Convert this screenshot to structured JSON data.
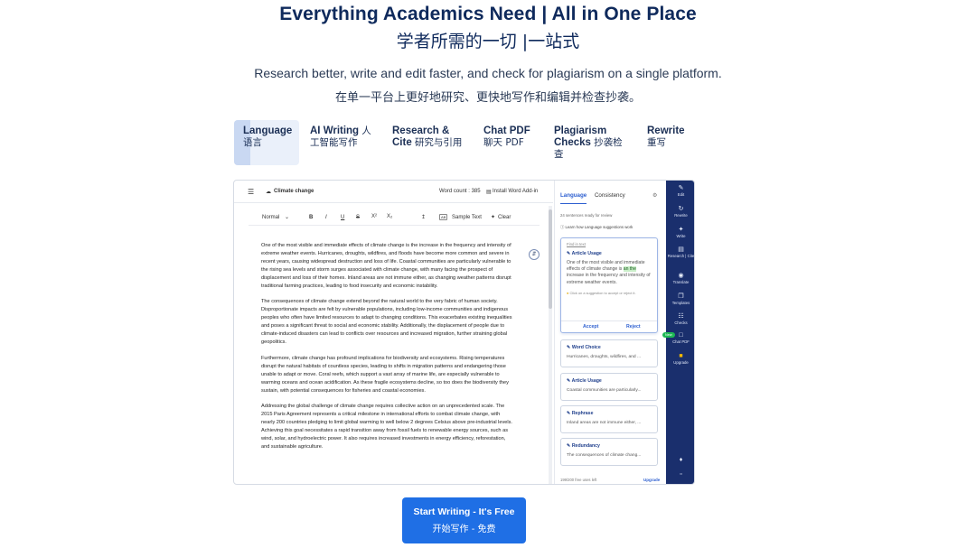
{
  "hero": {
    "title": "Everything Academics Need | All in One Place",
    "title_zh": "学者所需的一切 |一站式",
    "subtitle": "Research better, write and edit faster, and check for plagiarism on a single platform.",
    "subtitle_zh": "在单一平台上更好地研究、更快地写作和编辑并检查抄袭。"
  },
  "tabs": [
    {
      "label": "Language",
      "label_zh": "语言",
      "active": true
    },
    {
      "label": "AI Writing",
      "label_zh": "人工智能写作"
    },
    {
      "label": "Research & Cite",
      "label_zh": "研究与引用"
    },
    {
      "label": "Chat PDF",
      "label_zh": "聊天 PDF"
    },
    {
      "label": "Plagiarism Checks",
      "label_zh": "抄袭检查"
    },
    {
      "label": "Rewrite",
      "label_zh": "重写"
    }
  ],
  "editor": {
    "doc_title": "Climate change",
    "word_count": "Word count : 385",
    "install": "Install Word Add-in",
    "style_select": "Normal",
    "sample_text": "Sample Text",
    "clear": "Clear",
    "paragraphs": [
      "One of the most visible and immediate effects of climate change is the increase in the frequency and intensity of extreme weather events. Hurricanes, droughts, wildfires, and floods have become more common and severe in recent years, causing widespread destruction and loss of life. Coastal communities are particularly vulnerable to the rising sea levels and storm surges associated with climate change, with many facing the prospect of displacement and loss of their homes. Inland areas are not immune either, as changing weather patterns disrupt traditional farming practices, leading to food insecurity and economic instability.",
      "The consequences of climate change extend beyond the natural world to the very fabric of human society. Disproportionate impacts are felt by vulnerable populations, including low-income communities and indigenous peoples who often have limited resources to adapt to changing conditions. This exacerbates existing inequalities and poses a significant threat to social and economic stability. Additionally, the displacement of people due to climate-induced disasters can lead to conflicts over resources and increased migration, further straining global geopolitics.",
      "Furthermore, climate change has profound implications for biodiversity and ecosystems. Rising temperatures disrupt the natural habitats of countless species, leading to shifts in migration patterns and endangering those unable to adapt or move. Coral reefs, which support a vast array of marine life, are especially vulnerable to warming oceans and ocean acidification. As these fragile ecosystems decline, so too does the biodiversity they sustain, with potential consequences for fisheries and coastal economies.",
      "Addressing the global challenge of climate change requires collective action on an unprecedented scale. The 2015 Paris Agreement represents a critical milestone in international efforts to combat climate change, with nearly 200 countries pledging to limit global warming to well below 2 degrees Celsius above pre-industrial levels. Achieving this goal necessitates a rapid transition away from fossil fuels to renewable energy sources, such as wind, solar, and hydroelectric power. It also requires increased investments in energy efficiency, reforestation, and sustainable agriculture."
    ]
  },
  "panel": {
    "tab_language": "Language",
    "tab_consistency": "Consistency",
    "meta": "24 sentences ready for review",
    "learn": "Learn how Language suggestions work",
    "active_card": {
      "find": "Find in text",
      "heading": "Article Usage",
      "text_before": "One of the most visible and immediate effects of climate change is ",
      "text_added": "an the",
      "text_after": " increase in the frequency and intensity of extreme weather events.",
      "hint": "Click on a suggestion to accept or reject it.",
      "accept": "Accept",
      "reject": "Reject"
    },
    "cards": [
      {
        "heading": "Word Choice",
        "text": "Hurricanes, droughts, wildfires, and ..."
      },
      {
        "heading": "Article Usage",
        "text": "Coastal communities are particularly..."
      },
      {
        "heading": "Rephrase",
        "text": "Inland areas are not immune either, ..."
      },
      {
        "heading": "Redundancy",
        "text": "The consequences of climate chang..."
      }
    ],
    "footer_left": "199/200 free uses left",
    "footer_right": "Upgrade"
  },
  "rail": [
    {
      "icon": "pen",
      "label": "Edit"
    },
    {
      "icon": "rewrite",
      "label": "Rewrite"
    },
    {
      "icon": "write",
      "label": "Write"
    },
    {
      "icon": "research",
      "label": "Research | Cite"
    },
    {
      "icon": "globe",
      "label": "Translate"
    },
    {
      "icon": "templates",
      "label": "Templates"
    },
    {
      "icon": "checks",
      "label": "Checks"
    },
    {
      "icon": "chat-pdf",
      "label": "Chat PDF"
    },
    {
      "icon": "upgrade",
      "label": "Upgrade"
    }
  ],
  "rail_new_badge": "New",
  "cta": {
    "label": "Start Writing - It's Free",
    "label_zh": "开始写作 - 免费"
  }
}
